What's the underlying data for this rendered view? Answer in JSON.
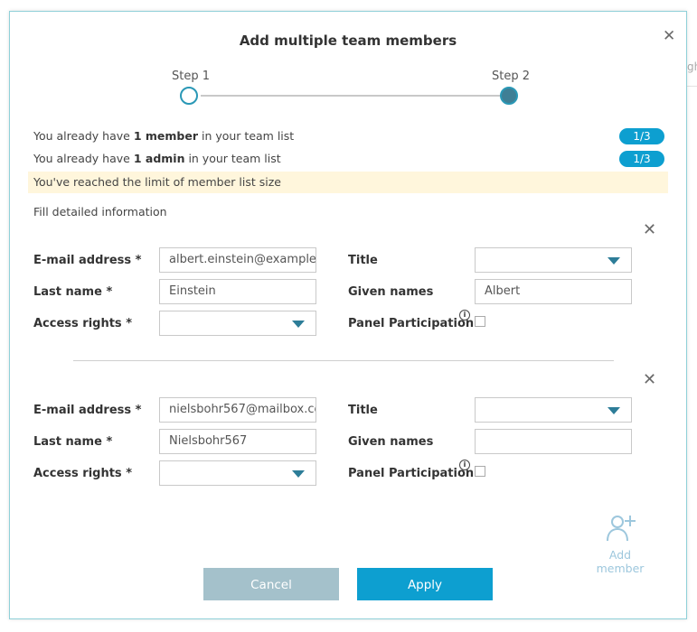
{
  "background": {
    "partial_text": "gh"
  },
  "modal": {
    "title": "Add multiple team members",
    "close_symbol": "✕"
  },
  "stepper": {
    "step1_label": "Step 1",
    "step2_label": "Step 2"
  },
  "info": {
    "member_prefix": "You already have ",
    "member_bold": "1 member",
    "member_suffix": " in your team list",
    "member_badge": "1/3",
    "admin_prefix": "You already have ",
    "admin_bold": "1 admin",
    "admin_suffix": " in your team list",
    "admin_badge": "1/3",
    "warning": "You've reached the limit of member list size",
    "fill_detailed": "Fill detailed information"
  },
  "labels": {
    "email": "E-mail address *",
    "last_name": "Last name *",
    "access_rights": "Access rights *",
    "title": "Title",
    "given_names": "Given names",
    "panel_participation": "Panel Participation",
    "info_symbol": "i",
    "remove_symbol": "✕"
  },
  "members": [
    {
      "email": "albert.einstein@example",
      "last_name": "Einstein",
      "access_rights": "",
      "title": "",
      "given_names": "Albert",
      "panel_participation": false
    },
    {
      "email": "nielsbohr567@mailbox.co",
      "last_name": "Nielsbohr567",
      "access_rights": "",
      "title": "",
      "given_names": "",
      "panel_participation": false
    }
  ],
  "add_member": {
    "label": "Add member",
    "icon": "add-user-icon"
  },
  "buttons": {
    "cancel": "Cancel",
    "apply": "Apply"
  },
  "colors": {
    "accent": "#0d9fd0",
    "cancel": "#a4c1cb",
    "warning_bg": "#fff6dc",
    "step_active": "#3f7f95"
  }
}
